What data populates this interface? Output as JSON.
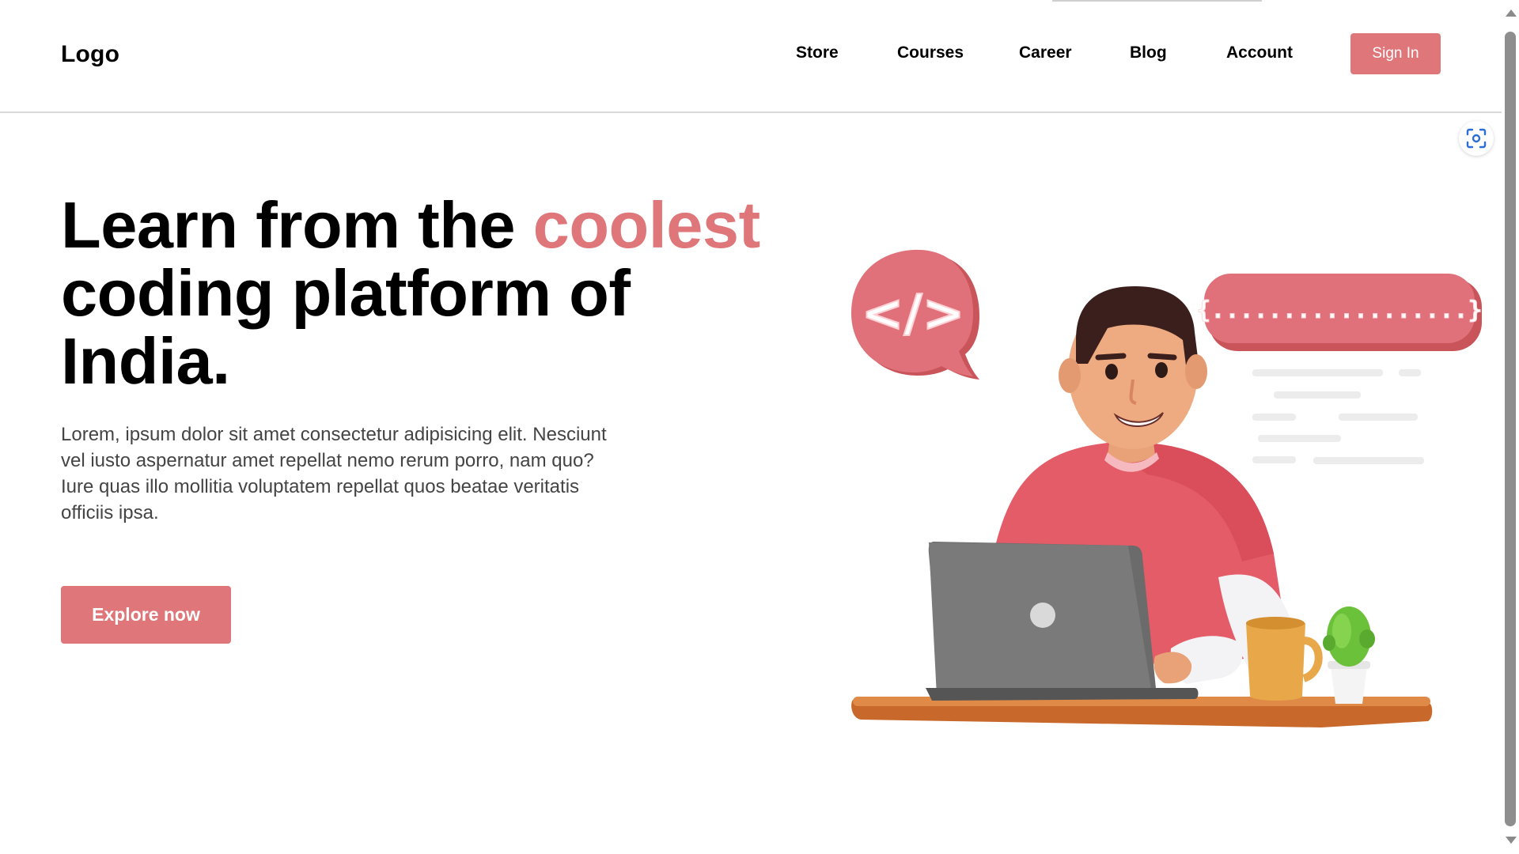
{
  "header": {
    "logo": "Logo",
    "nav": [
      {
        "label": "Store"
      },
      {
        "label": "Courses"
      },
      {
        "label": "Career"
      },
      {
        "label": "Blog"
      },
      {
        "label": "Account"
      }
    ],
    "sign_in_label": "Sign In"
  },
  "hero": {
    "title_part1": "Learn from the ",
    "title_accent": "coolest",
    "title_part2": "coding platform of India.",
    "description": "Lorem, ipsum dolor sit amet consectetur adipisicing elit. Nesciunt vel iusto aspernatur amet repellat nemo rerum porro, nam quo? Iure quas illo mollitia voluptatem repellat quos beatae veritatis officiis ipsa.",
    "cta_label": "Explore now"
  },
  "illustration": {
    "code_bubble_text": "</>",
    "braces_bubble_text": "{..................}"
  },
  "colors": {
    "accent": "#de767a",
    "text": "#000000",
    "muted_text": "#444444"
  },
  "icons": {
    "lens": "lens-icon",
    "scroll_up": "scroll-up-icon",
    "scroll_down": "scroll-down-icon"
  }
}
